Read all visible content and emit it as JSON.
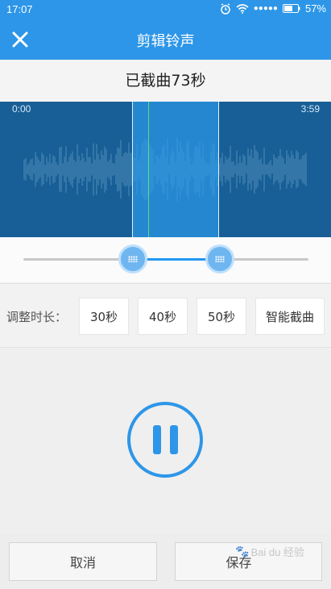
{
  "status_bar": {
    "time": "17:07",
    "battery": "57%",
    "signal_dots": "●●●●●",
    "alarm_icon": "alarm-icon",
    "wifi_icon": "wifi-icon",
    "battery_icon": "battery-icon"
  },
  "header": {
    "title": "剪辑铃声",
    "close_icon": "close-icon"
  },
  "cut_info": "已截曲73秒",
  "waveform": {
    "start_time": "0:00",
    "end_time": "3:59",
    "selection_color": "#2c9dee",
    "background_color": "#175f96",
    "playhead_color": "#4ee08a"
  },
  "duration": {
    "label": "调整时长：",
    "options": [
      "30秒",
      "40秒",
      "50秒",
      "智能截曲"
    ]
  },
  "player": {
    "state_icon": "pause-icon",
    "accent": "#2d96e8"
  },
  "actions": {
    "cancel": "取消",
    "save": "保存"
  },
  "watermark": {
    "text": "Bai du 经验"
  }
}
